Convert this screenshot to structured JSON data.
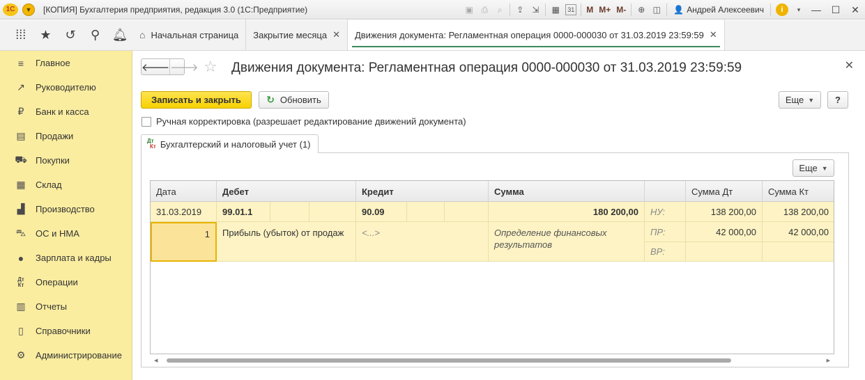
{
  "window": {
    "logo": "1С",
    "title": "[КОПИЯ] Бухгалтерия предприятия, редакция 3.0  (1С:Предприятие)",
    "m_buttons": [
      "M",
      "M+",
      "M-"
    ],
    "user": "Андрей Алексеевич",
    "calendar_day": "31"
  },
  "tabs": [
    {
      "label": "Начальная страница",
      "icon": "home-icon"
    },
    {
      "label": "Закрытие месяца",
      "closable": true
    },
    {
      "label": "Движения документа: Регламентная операция 0000-000030 от 31.03.2019 23:59:59",
      "closable": true,
      "active": true
    }
  ],
  "sidebar": {
    "items": [
      {
        "label": "Главное",
        "icon": "menu-icon"
      },
      {
        "label": "Руководителю",
        "icon": "trend-icon"
      },
      {
        "label": "Банк и касса",
        "icon": "ruble-icon"
      },
      {
        "label": "Продажи",
        "icon": "bag-icon"
      },
      {
        "label": "Покупки",
        "icon": "cart-icon"
      },
      {
        "label": "Склад",
        "icon": "warehouse-icon"
      },
      {
        "label": "Производство",
        "icon": "factory-icon"
      },
      {
        "label": "ОС и НМА",
        "icon": "truck-icon"
      },
      {
        "label": "Зарплата и кадры",
        "icon": "person-icon"
      },
      {
        "label": "Операции",
        "icon": "dt-kt-icon"
      },
      {
        "label": "Отчеты",
        "icon": "bar-chart-icon"
      },
      {
        "label": "Справочники",
        "icon": "book-icon"
      },
      {
        "label": "Администрирование",
        "icon": "gear-icon"
      }
    ],
    "dt_label": "Дт",
    "kt_label": "Кт"
  },
  "form": {
    "title": "Движения документа: Регламентная операция 0000-000030 от 31.03.2019 23:59:59",
    "save_close_label": "Записать и закрыть",
    "refresh_label": "Обновить",
    "more_label": "Еще",
    "help_label": "?",
    "manual_edit_label": "Ручная корректировка (разрешает редактирование движений документа)",
    "manual_edit_checked": false,
    "subtab_label": "Бухгалтерский и налоговый учет (1)",
    "panel_more_label": "Еще"
  },
  "grid": {
    "columns": [
      "Дата",
      "Дебет",
      "Кредит",
      "Сумма",
      "",
      "Сумма Дт",
      "Сумма Кт"
    ],
    "row": {
      "date": "31.03.2019",
      "number": "1",
      "debit_account": "99.01.1",
      "debit_subconto": "Прибыль (убыток) от продаж",
      "credit_account": "90.09",
      "credit_subconto": "<...>",
      "amount": "180 200,00",
      "content": "Определение финансовых результатов",
      "nu_label": "НУ:",
      "pr_label": "ПР:",
      "vr_label": "ВР:",
      "sum_dt_nu": "138 200,00",
      "sum_kt_nu": "138 200,00",
      "sum_dt_pr": "42 000,00",
      "sum_kt_pr": "42 000,00"
    }
  }
}
